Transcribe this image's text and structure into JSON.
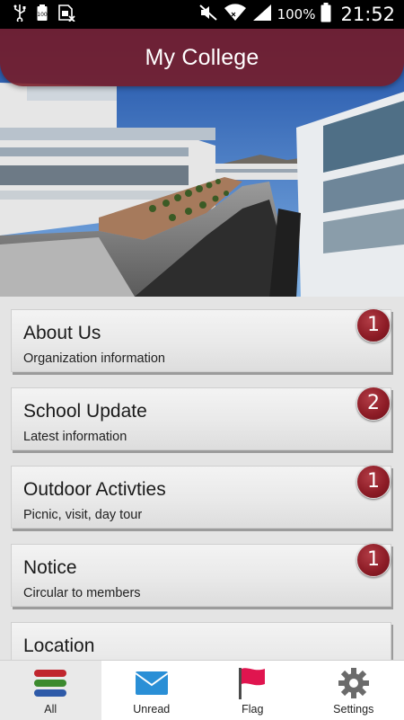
{
  "statusbar": {
    "battery_percent": "100%",
    "time": "21:52",
    "icons": [
      "usb-icon",
      "battery-saver-icon",
      "sim-icon",
      "mute-icon",
      "wifi-icon",
      "signal-icon",
      "battery-icon"
    ]
  },
  "header": {
    "title": "My College"
  },
  "list": {
    "items": [
      {
        "title": "About Us",
        "subtitle": "Organization information",
        "badge": "1"
      },
      {
        "title": "School Update",
        "subtitle": "Latest information",
        "badge": "2"
      },
      {
        "title": "Outdoor Activties",
        "subtitle": "Picnic, visit, day tour",
        "badge": "1"
      },
      {
        "title": "Notice",
        "subtitle": "Circular to members",
        "badge": "1"
      },
      {
        "title": "Location",
        "subtitle": "",
        "badge": ""
      }
    ]
  },
  "bottomnav": {
    "tabs": [
      {
        "label": "All",
        "icon": "stack-icon"
      },
      {
        "label": "Unread",
        "icon": "envelope-icon"
      },
      {
        "label": "Flag",
        "icon": "flag-icon"
      },
      {
        "label": "Settings",
        "icon": "gear-icon"
      }
    ]
  },
  "colors": {
    "accent": "#8e1d27",
    "titlebar": "#781a26"
  }
}
